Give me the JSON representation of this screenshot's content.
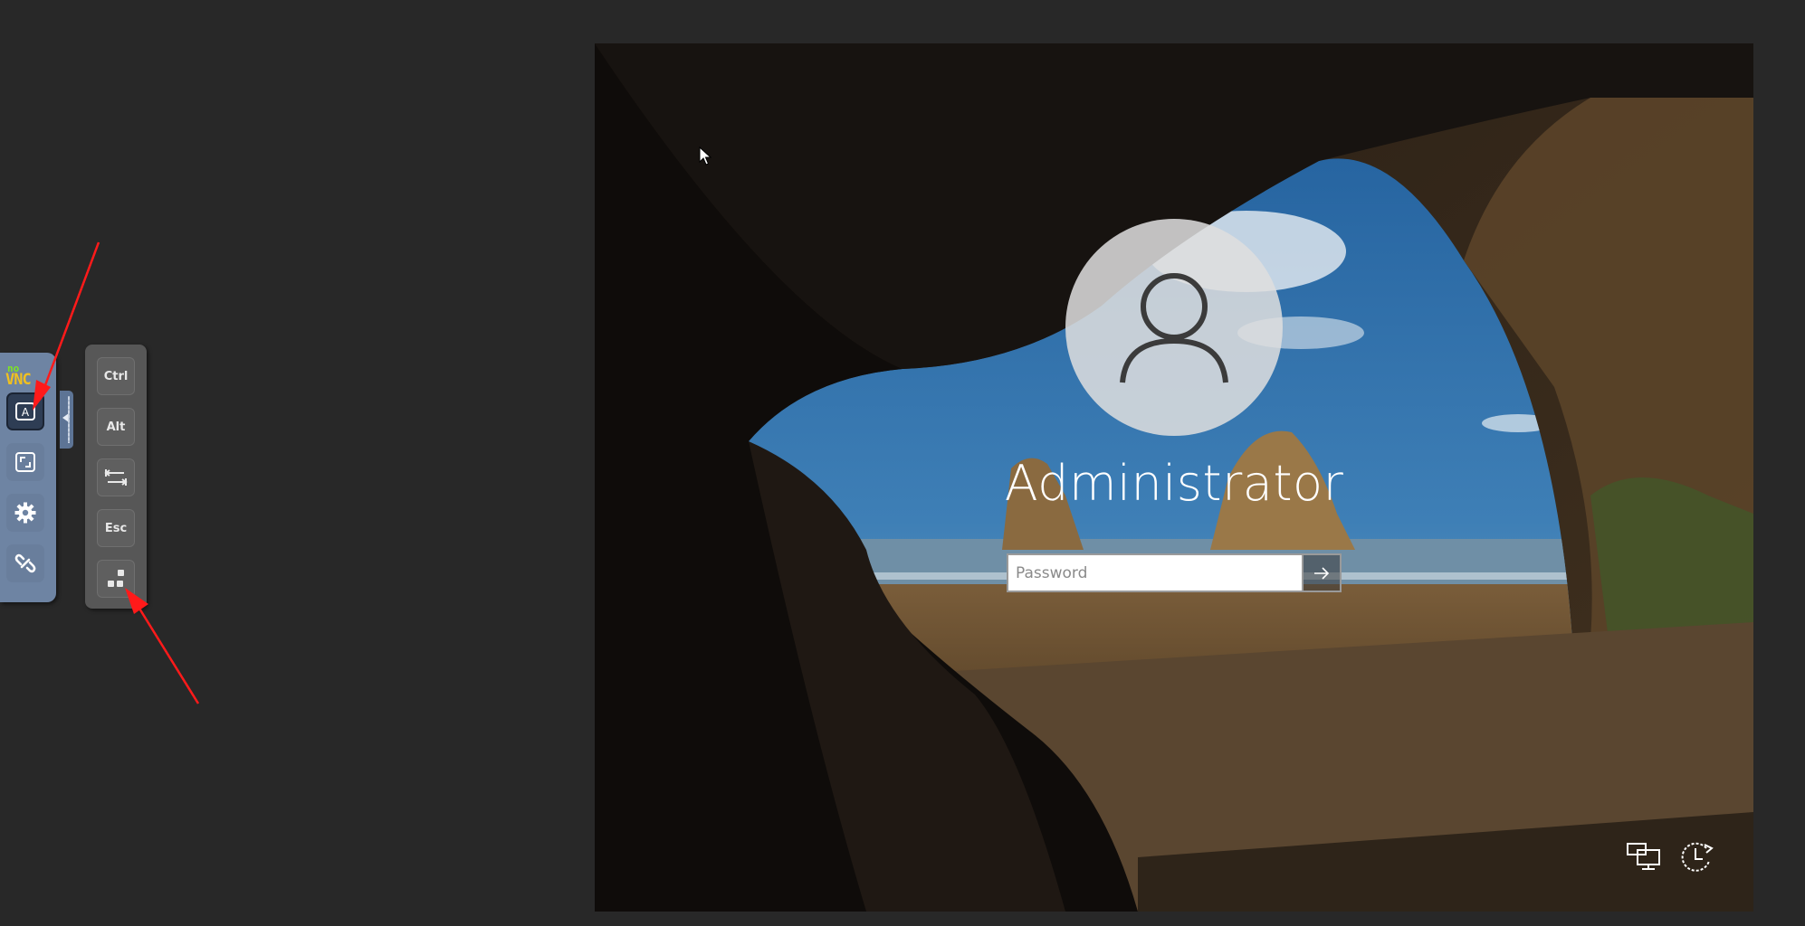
{
  "vnc": {
    "logo_no": "no",
    "logo_vnc": "VNC",
    "controls": [
      {
        "name": "keyboard-button",
        "icon": "keyboard-a-icon",
        "active": true
      },
      {
        "name": "fullscreen-button",
        "icon": "fullscreen-icon"
      },
      {
        "name": "settings-button",
        "icon": "gear-icon"
      },
      {
        "name": "disconnect-button",
        "icon": "broken-link-icon"
      }
    ],
    "extra_keys": {
      "ctrl": "Ctrl",
      "alt": "Alt",
      "tab": "tab-icon",
      "esc": "Esc",
      "ctrl_alt_del": "ctrl-alt-del-icon"
    }
  },
  "login": {
    "username": "Administrator",
    "password_placeholder": "Password"
  },
  "colors": {
    "page_bg": "#282828",
    "control_bar": "#6e84a3",
    "keys_panel": "#575757",
    "annotation_arrow": "#ff1a1a"
  }
}
